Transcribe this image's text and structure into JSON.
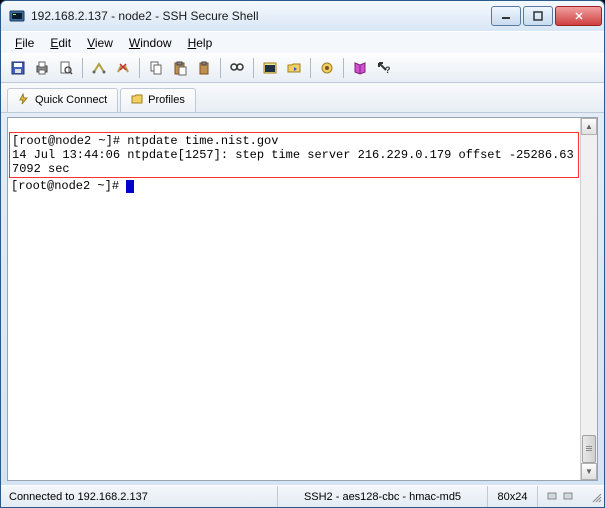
{
  "titlebar": {
    "title": "192.168.2.137 - node2 - SSH Secure Shell"
  },
  "menu": {
    "file": "File",
    "edit": "Edit",
    "view": "View",
    "window": "Window",
    "help": "Help"
  },
  "tabs": {
    "quick_connect": "Quick Connect",
    "profiles": "Profiles"
  },
  "terminal": {
    "line1": "[root@node2 ~]# ntpdate time.nist.gov",
    "line2": "14 Jul 13:44:06 ntpdate[1257]: step time server 216.229.0.179 offset -25286.637092 sec",
    "prompt": "[root@node2 ~]# "
  },
  "status": {
    "connected": "Connected to 192.168.2.137",
    "encryption": "SSH2 - aes128-cbc - hmac-md5",
    "dimensions": "80x24"
  }
}
